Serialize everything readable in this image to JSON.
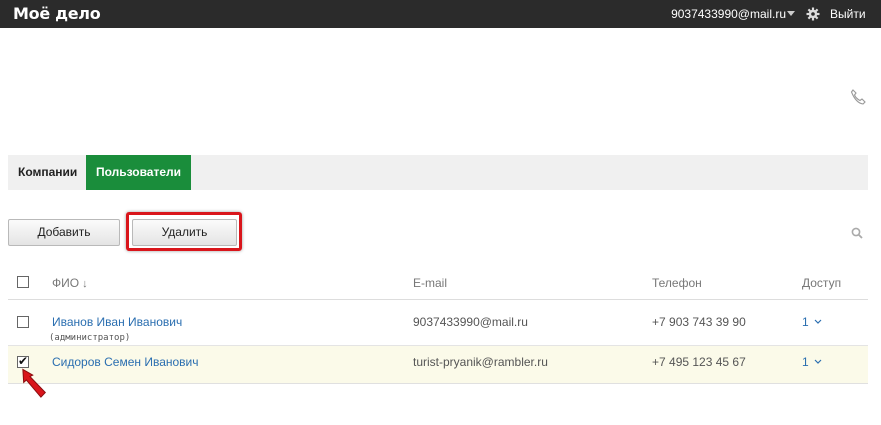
{
  "header": {
    "logo": "Моё дело",
    "user_email": "9037433990@mail.ru",
    "logout": "Выйти"
  },
  "tabs": [
    {
      "label": "Компании",
      "active": false
    },
    {
      "label": "Пользователи",
      "active": true
    }
  ],
  "toolbar": {
    "add_label": "Добавить",
    "delete_label": "Удалить"
  },
  "table": {
    "columns": [
      "ФИО",
      "E-mail",
      "Телефон",
      "Доступ"
    ],
    "sort_indicator": "↓",
    "rows": [
      {
        "name": "Иванов Иван Иванович",
        "role": "(администратор)",
        "email": "9037433990@mail.ru",
        "phone": "+7 903 743 39 90",
        "access": "1",
        "checked": false
      },
      {
        "name": "Сидоров Семен Иванович",
        "role": "",
        "email": "turist-pryanik@rambler.ru",
        "phone": "+7 495 123 45 67",
        "access": "1",
        "checked": true
      }
    ]
  },
  "colors": {
    "topbar": "#2b2b2b",
    "active_tab": "#1a8d3b",
    "link": "#2a6eb0",
    "highlight": "#d9151b",
    "selected_row": "#fbfae9"
  },
  "icons": [
    "gear-icon",
    "phone-icon",
    "search-icon",
    "chevron-down-icon",
    "pointer-arrow-icon"
  ]
}
